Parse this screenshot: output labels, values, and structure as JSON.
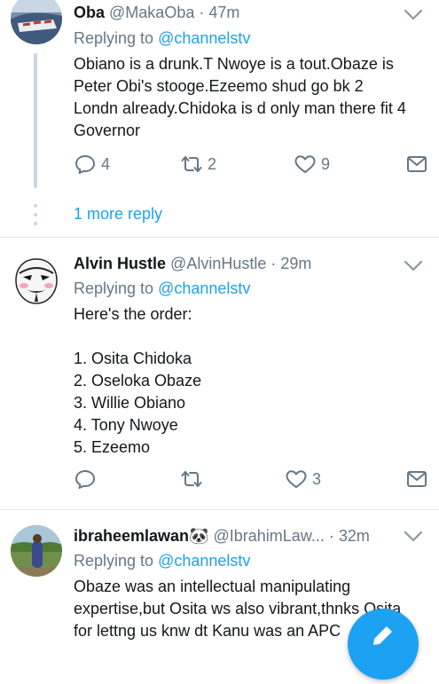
{
  "tweets": [
    {
      "name": "Oba",
      "handle": "@MakaOba",
      "time": "· 47m",
      "replying_label": "Replying to",
      "mention": "@channelstv",
      "text": "Obiano is a drunk.T Nwoye is a tout.Obaze is\nPeter Obi's stooge.Ezeemo shud go bk 2\nLondn already.Chidoka is d only man there fit 4\nGovernor",
      "replies": "4",
      "retweets": "2",
      "likes": "9",
      "more_reply": "1 more reply"
    },
    {
      "name": "Alvin Hustle",
      "handle": "@AlvinHustle",
      "time": "· 29m",
      "replying_label": "Replying to",
      "mention": "@channelstv",
      "text": "Here's the order:\n\n1. Osita Chidoka\n2. Oseloka Obaze\n3. Willie Obiano\n4. Tony Nwoye\n5. Ezeemo",
      "replies": "",
      "retweets": "",
      "likes": "3"
    },
    {
      "name": "ibraheemlawan",
      "emoji": "🐼",
      "handle": "@IbrahimLaw...",
      "time": "· 32m",
      "replying_label": "Replying to",
      "mention": "@channelstv",
      "text": "Obaze was an intellectual manipulating\nexpertise,but Osita ws also vibrant,thnks Osita\nfor lettng us knw dt Kanu was an APC      st"
    }
  ],
  "colors": {
    "accent": "#1da1f2",
    "muted": "#657786",
    "divider": "#e1e8ed"
  },
  "icons": [
    "reply-icon",
    "retweet-icon",
    "like-icon",
    "dm-icon",
    "chevron-down-icon",
    "compose-icon"
  ]
}
